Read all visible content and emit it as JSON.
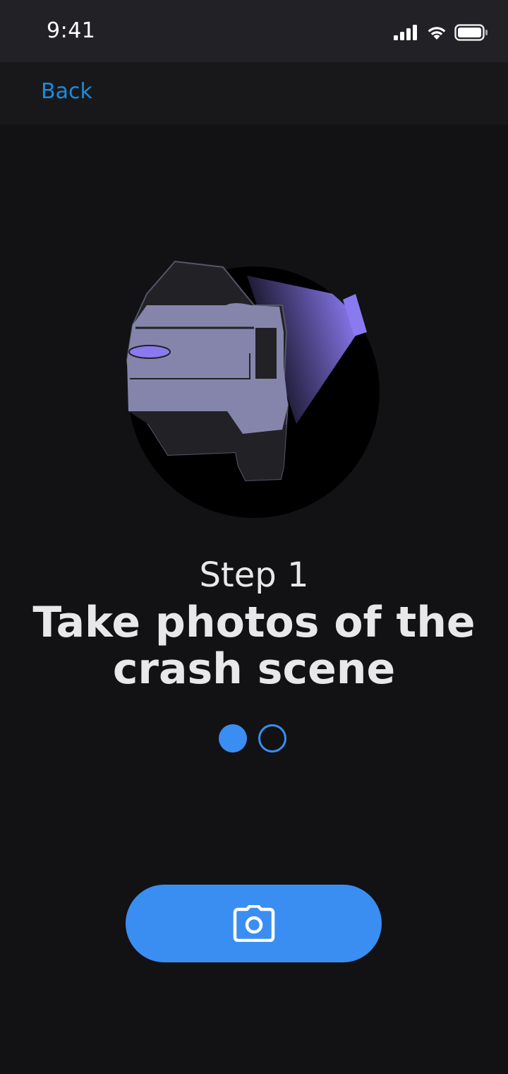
{
  "status_bar": {
    "time": "9:41",
    "icons": [
      "cellular-signal-icon",
      "wifi-icon",
      "battery-icon"
    ]
  },
  "nav": {
    "back_label": "Back"
  },
  "illustration": {
    "icon": "car-flash-photo-illustration"
  },
  "step": {
    "label": "Step 1",
    "title": "Take photos of the crash scene"
  },
  "pager": {
    "total": 2,
    "active_index": 0
  },
  "action": {
    "icon": "camera-icon"
  },
  "colors": {
    "background": "#121214",
    "accent": "#3a8ef2",
    "link": "#1a8be0",
    "car_body": "#8585ac",
    "flash": "#8a7af0"
  }
}
